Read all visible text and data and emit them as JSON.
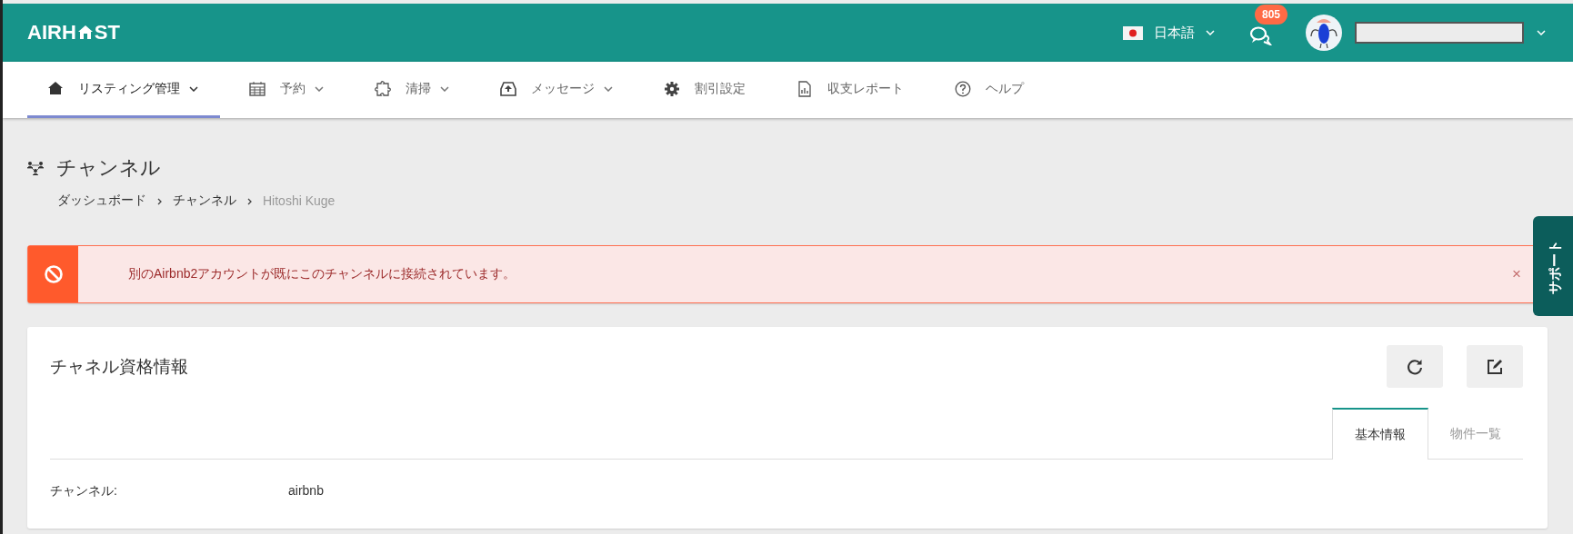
{
  "header": {
    "logo": {
      "before": "AIRH",
      "after": "ST"
    },
    "language": {
      "label": "日本語",
      "dropdown": true
    },
    "messages_badge": "805",
    "user": {
      "dropdown": true
    }
  },
  "nav": [
    {
      "label": "リスティング管理",
      "kind": "home",
      "dropdown": true,
      "selected": true
    },
    {
      "label": "予約",
      "kind": "calendar",
      "dropdown": true,
      "selected": false
    },
    {
      "label": "清掃",
      "kind": "puzzle",
      "dropdown": true,
      "selected": false
    },
    {
      "label": "メッセージ",
      "kind": "inbox",
      "dropdown": true,
      "selected": false
    },
    {
      "label": "割引設定",
      "kind": "gear",
      "dropdown": false,
      "selected": false
    },
    {
      "label": "収支レポート",
      "kind": "report",
      "dropdown": false,
      "selected": false
    },
    {
      "label": "ヘルプ",
      "kind": "help",
      "dropdown": false,
      "selected": false
    }
  ],
  "page": {
    "title": "チャンネル",
    "breadcrumb": [
      {
        "label": "ダッシュボード",
        "current": false
      },
      {
        "label": "チャンネル",
        "current": false
      },
      {
        "label": "Hitoshi Kuge",
        "current": true
      }
    ]
  },
  "alert": {
    "message": "別のAirbnb2アカウントが既にこのチャンネルに接続されています。",
    "close": "×"
  },
  "support_tab": "サポート",
  "card": {
    "title": "チャネル資格情報",
    "tabs": [
      {
        "label": "基本情報",
        "selected": true
      },
      {
        "label": "物件一覧",
        "selected": false
      }
    ],
    "fields": [
      {
        "label": "チャンネル:",
        "value": "airbnb"
      }
    ]
  }
}
